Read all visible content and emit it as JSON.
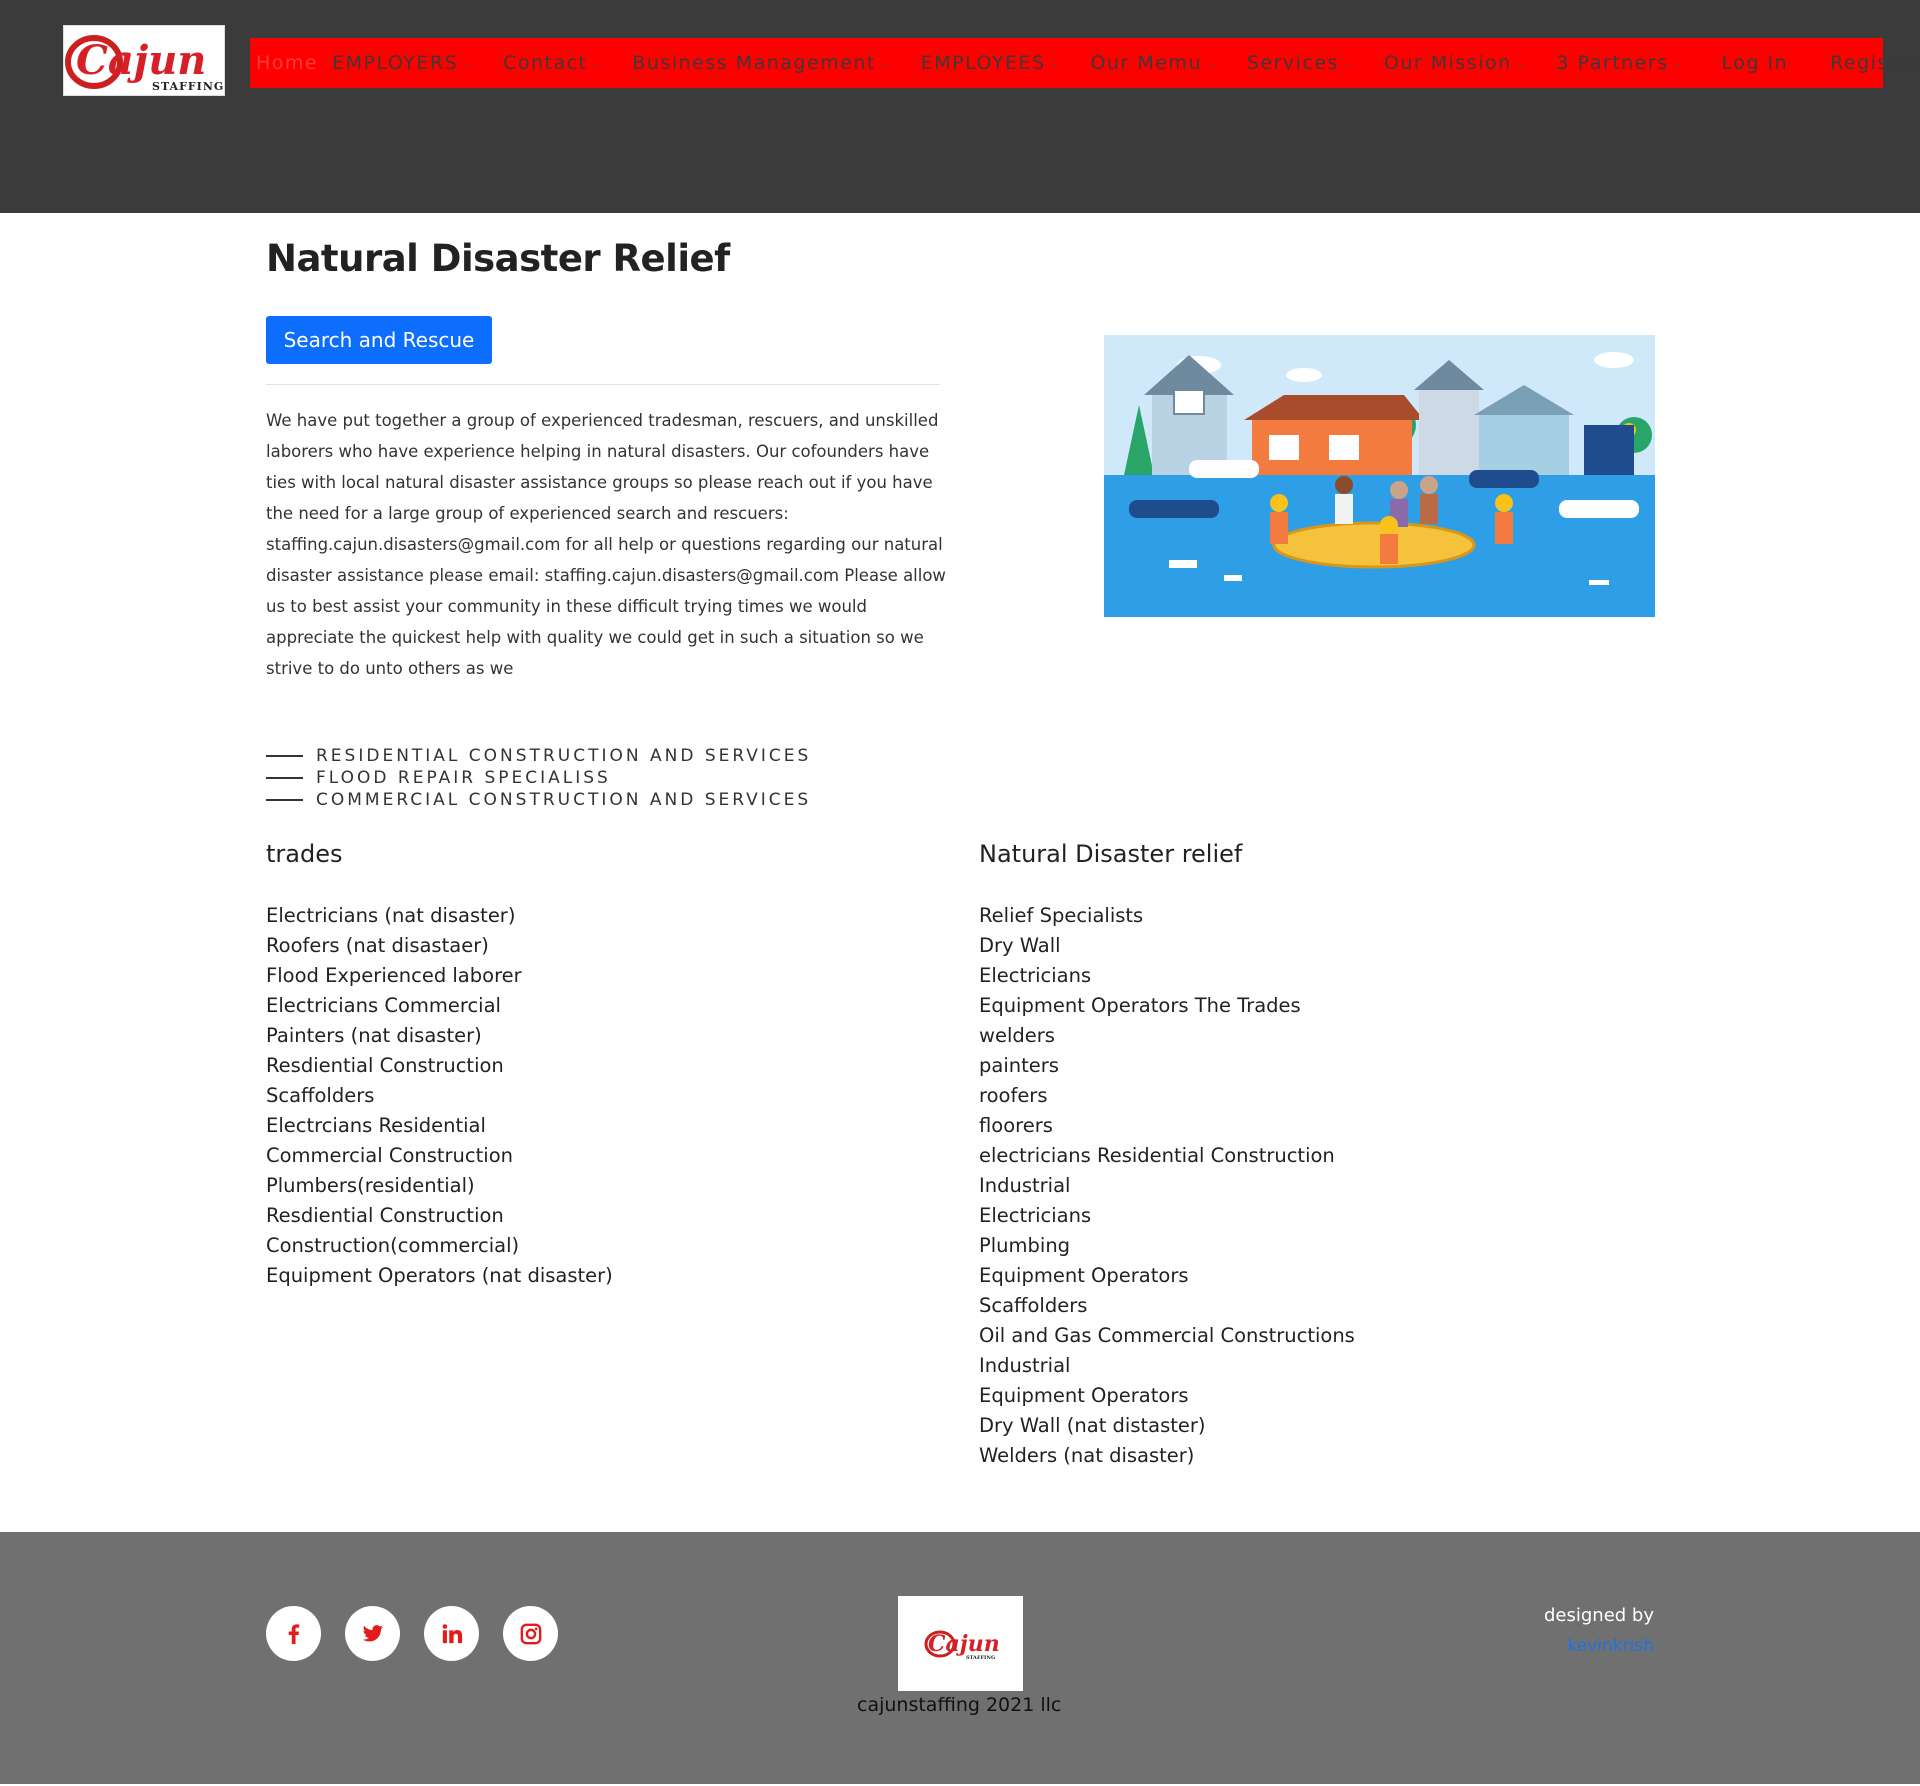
{
  "brand": {
    "logo_text": "Cajun",
    "logo_subtext": "STAFFING",
    "accent_color": "#ff0000",
    "header_bg": "#3b3b3b",
    "footer_bg": "#707070",
    "button_color": "#0d6efd"
  },
  "nav": {
    "items": [
      {
        "label": "Home",
        "dropdown": false
      },
      {
        "label": "EMPLOYERS",
        "dropdown": true
      },
      {
        "label": "Contact",
        "dropdown": true
      },
      {
        "label": "Business Management",
        "dropdown": true
      },
      {
        "label": "EMPLOYEES",
        "dropdown": true
      },
      {
        "label": "Our Memu",
        "dropdown": true
      },
      {
        "label": "Services",
        "dropdown": true
      },
      {
        "label": "Our Mission",
        "dropdown": true
      },
      {
        "label": "3 Partners",
        "dropdown": true
      },
      {
        "label": "Log In",
        "dropdown": false
      },
      {
        "label": "Register",
        "dropdown": false
      }
    ]
  },
  "main": {
    "title": "Natural Disaster Relief",
    "button_label": "Search and Rescue",
    "intro": "We have put together a group of experienced tradesman, rescuers, and unskilled laborers who have experience helping in natural disasters. Our cofounders have ties with local natural disaster assistance groups so please reach out if you have the need for a large group of experienced search and rescuers: staffing.cajun.disasters@gmail.com for all help or questions regarding our natural disaster assistance please email: staffing.cajun.disasters@gmail.com Please allow us to best assist your community in these difficult trying times we would appreciate the quickest help with quality we could get in such a situation so we strive to do unto others as we",
    "features": [
      "RESIDENTIAL CONSTRUCTION AND SERVICES",
      "FLOOD REPAIR SPECIALISS",
      "COMMERCIAL CONSTRUCTION AND SERVICES"
    ]
  },
  "trades": {
    "heading": "trades",
    "items": [
      "Electricians (nat disaster)",
      "Roofers (nat disastaer)",
      "Flood Experienced laborer",
      "Electricians Commercial",
      "Painters (nat disaster)",
      "Resdiential Construction",
      "Scaffolders",
      "Electrcians Residential",
      "Commercial Construction",
      "Plumbers(residential)",
      "Resdiential Construction",
      "Construction(commercial)",
      "Equipment Operators (nat disaster)"
    ]
  },
  "relief": {
    "heading": "Natural Disaster relief",
    "items": [
      "Relief Specialists",
      "Dry Wall",
      "Electricians",
      "Equipment Operators The Trades",
      "welders",
      "painters",
      "roofers",
      "floorers",
      "electricians Residential Construction",
      "Industrial",
      "Electricians",
      "Plumbing",
      "Equipment Operators",
      "Scaffolders",
      "Oil and Gas Commercial Constructions",
      "Industrial",
      "Equipment Operators",
      "Dry Wall (nat distaster)",
      "Welders (nat disaster)"
    ]
  },
  "footer": {
    "social": [
      "facebook-icon",
      "twitter-icon",
      "linkedin-icon",
      "instagram-icon"
    ],
    "copyright": "cajunstaffing 2021 llc",
    "designed_by": "designed by",
    "designer": "kevinkrish"
  }
}
